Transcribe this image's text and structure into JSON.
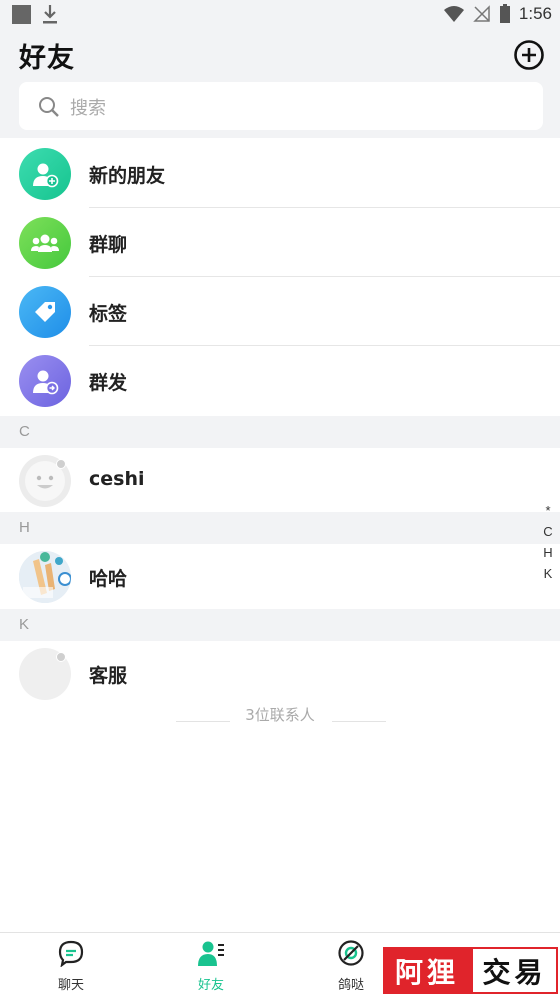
{
  "status_bar": {
    "time": "1:56"
  },
  "header": {
    "title": "好友"
  },
  "search": {
    "placeholder": "搜索"
  },
  "menu": [
    {
      "label": "新的朋友",
      "icon": "add-friend-icon",
      "color": "#1fcf9e"
    },
    {
      "label": "群聊",
      "icon": "group-chat-icon",
      "color": "#5fd24f"
    },
    {
      "label": "标签",
      "icon": "tag-icon",
      "color": "#2fa2ee"
    },
    {
      "label": "群发",
      "icon": "broadcast-icon",
      "color": "#8075e6"
    }
  ],
  "sections": [
    {
      "letter": "C",
      "contact": "ceshi"
    },
    {
      "letter": "H",
      "contact": "哈哈"
    },
    {
      "letter": "K",
      "contact": "客服"
    }
  ],
  "contact_count": "3位联系人",
  "index_bar": [
    "*",
    "C",
    "H",
    "K"
  ],
  "tabs": [
    {
      "label": "聊天",
      "icon": "chat-icon"
    },
    {
      "label": "好友",
      "icon": "friends-icon",
      "active": true
    },
    {
      "label": "鸽哒",
      "icon": "discover-icon"
    }
  ],
  "watermark": {
    "left": "阿狸",
    "right": "交易"
  },
  "colors": {
    "accent": "#19c38f",
    "background": "#f2f3f5"
  }
}
